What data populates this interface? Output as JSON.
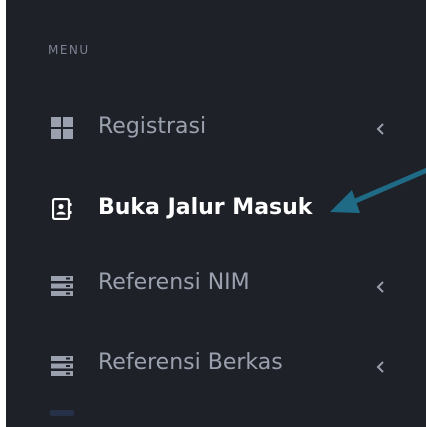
{
  "sidebar": {
    "header": "MENU",
    "items": [
      {
        "label": "Registrasi",
        "icon": "dashboard-grid-icon",
        "has_submenu": true
      },
      {
        "label": "Buka Jalur Masuk",
        "icon": "contact-card-icon",
        "has_submenu": false,
        "active": true
      },
      {
        "label": "Referensi NIM",
        "icon": "server-list-icon",
        "has_submenu": true
      },
      {
        "label": "Referensi Berkas",
        "icon": "server-list-icon",
        "has_submenu": true
      }
    ]
  },
  "annotation": {
    "type": "pointer-arrow",
    "color": "#1f6b86",
    "points_to": "Buka Jalur Masuk"
  },
  "colors": {
    "sidebar_bg": "#1f2129",
    "text_inactive": "#9aa0ad",
    "text_active": "#ffffff",
    "header_text": "#7c8292"
  }
}
